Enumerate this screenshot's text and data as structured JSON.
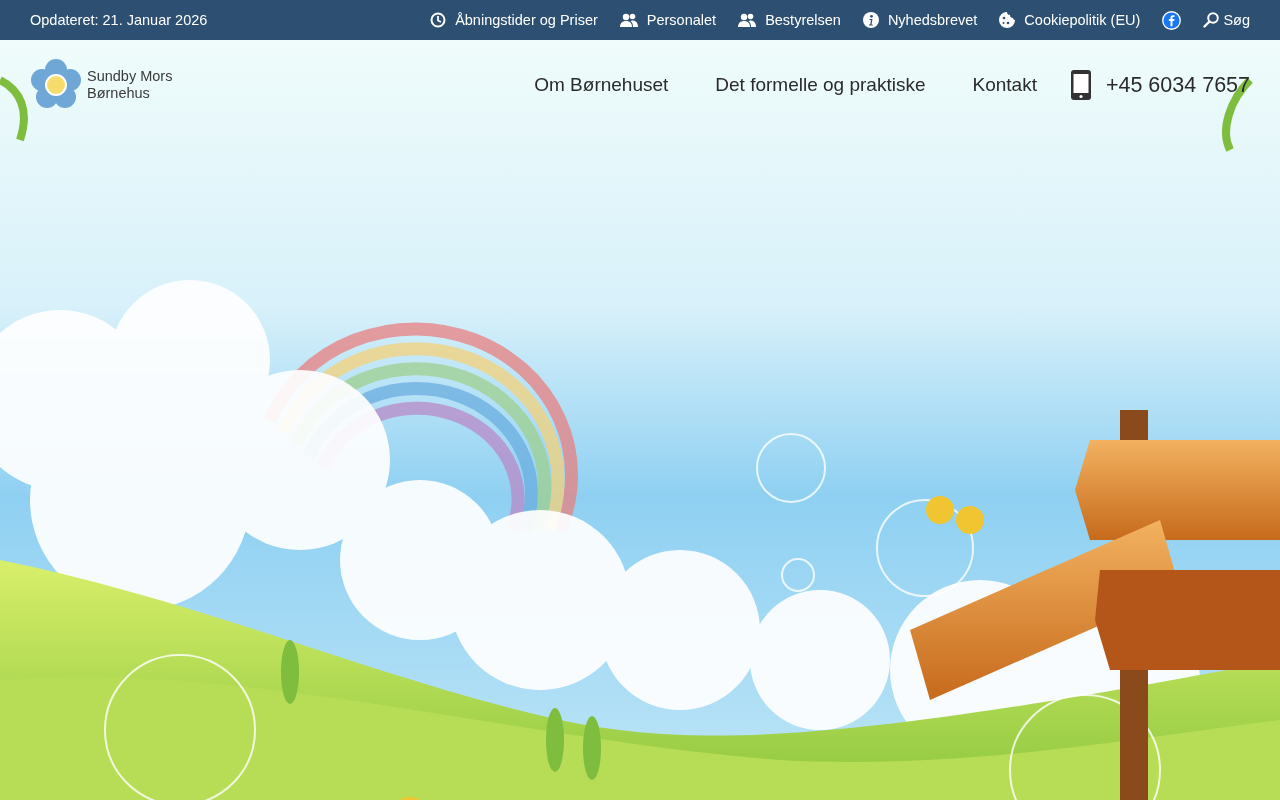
{
  "top_bar": {
    "updated": "Opdateret: 21. Januar 2026",
    "links": [
      {
        "kind": "clock",
        "label": "Åbningstider og Priser"
      },
      {
        "kind": "people",
        "label": "Personalet"
      },
      {
        "kind": "people",
        "label": "Bestyrelsen"
      },
      {
        "kind": "info",
        "label": "Nyhedsbrevet"
      },
      {
        "kind": "cookie",
        "label": "Cookiepolitik (EU)"
      },
      {
        "kind": "facebook"
      },
      {
        "kind": "search",
        "label": "Søg"
      }
    ]
  },
  "header": {
    "logo_lines": [
      "Sundby Mors",
      "Børnehus"
    ],
    "nav": [
      "Om Børnehuset",
      "Det formelle og praktiske",
      "Kontakt"
    ],
    "phone": "+45 6034 7657"
  }
}
